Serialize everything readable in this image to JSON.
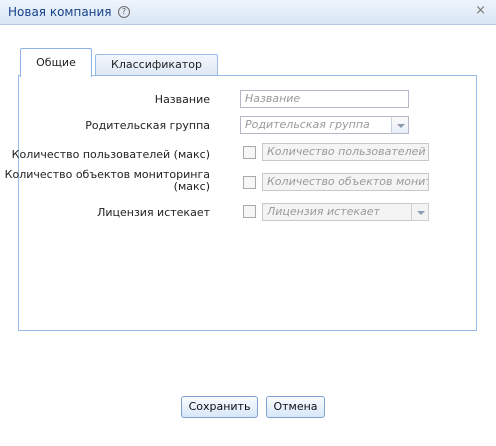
{
  "dialog": {
    "title": "Новая компания",
    "help_icon": "?",
    "close_icon": "×"
  },
  "tabs": [
    {
      "label": "Общие",
      "active": true
    },
    {
      "label": "Классификатор",
      "active": false
    }
  ],
  "form": {
    "name_label": "Название",
    "name_placeholder": "Название",
    "parent_label": "Родительская группа",
    "parent_placeholder": "Родительская группа",
    "users_label": "Количество пользователей (макс)",
    "users_placeholder": "Количество пользователей (",
    "objects_label_line1": "Количество объектов мониторинга",
    "objects_label_line2": "(макс)",
    "objects_placeholder": "Количество объектов монито",
    "license_label": "Лицензия истекает",
    "license_placeholder": "Лицензия истекает"
  },
  "buttons": {
    "save": "Сохранить",
    "cancel": "Отмена"
  }
}
